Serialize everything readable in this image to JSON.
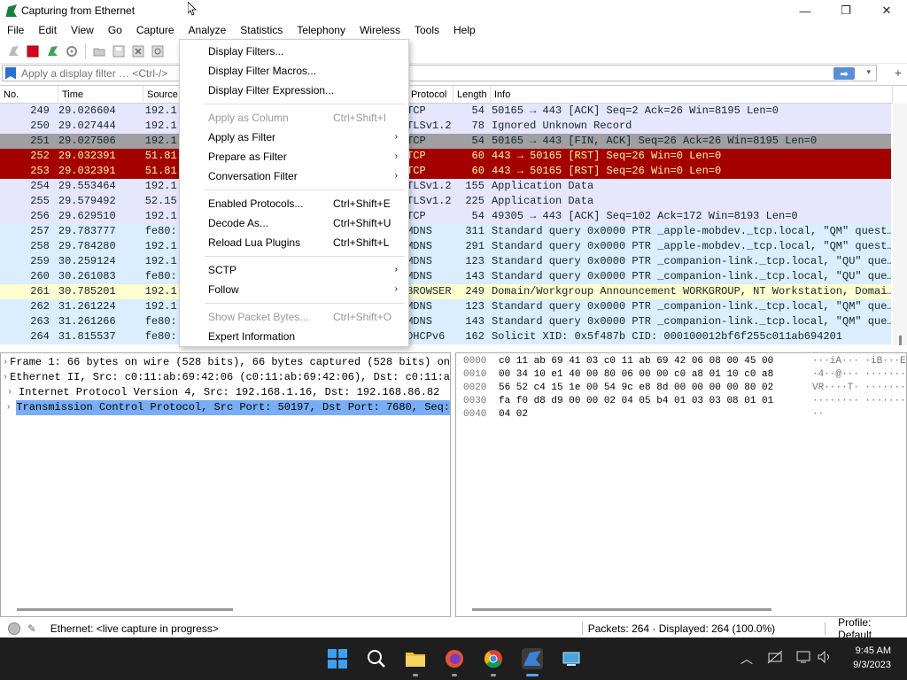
{
  "window": {
    "title": "Capturing from Ethernet",
    "controls": {
      "minimize": "—",
      "maximize": "❐",
      "close": "✕"
    }
  },
  "menubar": [
    "File",
    "Edit",
    "View",
    "Go",
    "Capture",
    "Analyze",
    "Statistics",
    "Telephony",
    "Wireless",
    "Tools",
    "Help"
  ],
  "filter": {
    "placeholder": "Apply a display filter … <Ctrl-/>",
    "apply_glyph": "➡",
    "dropdown_glyph": "▾",
    "add_glyph": "+"
  },
  "packet_list": {
    "columns": [
      "No.",
      "Time",
      "Source",
      "Protocol",
      "Length",
      "Info"
    ],
    "rows": [
      {
        "no": "249",
        "time": "29.026604",
        "src": "192.1",
        "proto": "TCP",
        "len": "54",
        "info": "50165 → 443 [ACK] Seq=2 Ack=26 Win=8195 Len=0",
        "style": "tcp"
      },
      {
        "no": "250",
        "time": "29.027444",
        "src": "192.1",
        "proto": "TLSv1.2",
        "len": "78",
        "info": "Ignored Unknown Record",
        "style": "tcp"
      },
      {
        "no": "251",
        "time": "29.027506",
        "src": "192.1",
        "proto": "TCP",
        "len": "54",
        "info": "50165 → 443 [FIN, ACK] Seq=26 Ack=26 Win=8195 Len=0",
        "style": "fin"
      },
      {
        "no": "252",
        "time": "29.032391",
        "src": "51.81",
        "proto": "TCP",
        "len": "60",
        "info": "443 → 50165 [RST] Seq=26 Win=0 Len=0",
        "style": "rst"
      },
      {
        "no": "253",
        "time": "29.032391",
        "src": "51.81",
        "proto": "TCP",
        "len": "60",
        "info": "443 → 50165 [RST] Seq=26 Win=0 Len=0",
        "style": "rst"
      },
      {
        "no": "254",
        "time": "29.553464",
        "src": "192.1",
        "proto": "TLSv1.2",
        "len": "155",
        "info": "Application Data",
        "style": "tcp"
      },
      {
        "no": "255",
        "time": "29.579492",
        "src": "52.15",
        "proto": "TLSv1.2",
        "len": "225",
        "info": "Application Data",
        "style": "tcp"
      },
      {
        "no": "256",
        "time": "29.629510",
        "src": "192.1",
        "proto": "TCP",
        "len": "54",
        "info": "49305 → 443 [ACK] Seq=102 Ack=172 Win=8193 Len=0",
        "style": "tcp"
      },
      {
        "no": "257",
        "time": "29.783777",
        "src": "fe80:",
        "proto": "MDNS",
        "len": "311",
        "info": "Standard query 0x0000 PTR _apple-mobdev._tcp.local, \"QM\" quest…",
        "style": "udp"
      },
      {
        "no": "258",
        "time": "29.784280",
        "src": "192.1",
        "proto": "MDNS",
        "len": "291",
        "info": "Standard query 0x0000 PTR _apple-mobdev._tcp.local, \"QM\" quest…",
        "style": "udp"
      },
      {
        "no": "259",
        "time": "30.259124",
        "src": "192.1",
        "proto": "MDNS",
        "len": "123",
        "info": "Standard query 0x0000 PTR _companion-link._tcp.local, \"QU\" que…",
        "style": "udp"
      },
      {
        "no": "260",
        "time": "30.261083",
        "src": "fe80:",
        "proto": "MDNS",
        "len": "143",
        "info": "Standard query 0x0000 PTR _companion-link._tcp.local, \"QU\" que…",
        "style": "udp"
      },
      {
        "no": "261",
        "time": "30.785201",
        "src": "192.1",
        "proto": "BROWSER",
        "len": "249",
        "info": "Domain/Workgroup Announcement WORKGROUP, NT Workstation, Domai…",
        "style": "browser"
      },
      {
        "no": "262",
        "time": "31.261224",
        "src": "192.1",
        "proto": "MDNS",
        "len": "123",
        "info": "Standard query 0x0000 PTR _companion-link._tcp.local, \"QM\" que…",
        "style": "udp"
      },
      {
        "no": "263",
        "time": "31.261266",
        "src": "fe80:",
        "proto": "MDNS",
        "len": "143",
        "info": "Standard query 0x0000 PTR _companion-link._tcp.local, \"QM\" que…",
        "style": "udp"
      },
      {
        "no": "264",
        "time": "31.815537",
        "src": "fe80:",
        "proto": "DHCPv6",
        "len": "162",
        "info": "Solicit XID: 0x5f487b CID: 000100012bf6f255c011ab694201",
        "style": "udp"
      }
    ]
  },
  "row_colors": {
    "tcp": {
      "bg": "#e7e6ff",
      "fg": "#12272e"
    },
    "fin": {
      "bg": "#a0a0a0",
      "fg": "#12272e"
    },
    "rst": {
      "bg": "#a40000",
      "fg": "#fffc9c"
    },
    "udp": {
      "bg": "#daeeff",
      "fg": "#12272e"
    },
    "browser": {
      "bg": "#fefed0",
      "fg": "#12272e"
    }
  },
  "details": [
    {
      "text": "Frame 1: 66 bytes on wire (528 bits), 66 bytes captured (528 bits) on",
      "selected": false
    },
    {
      "text": "Ethernet II, Src: c0:11:ab:69:42:06 (c0:11:ab:69:42:06), Dst: c0:11:a",
      "selected": false
    },
    {
      "text": "Internet Protocol Version 4, Src: 192.168.1.16, Dst: 192.168.86.82",
      "selected": false
    },
    {
      "text": "Transmission Control Protocol, Src Port: 50197, Dst Port: 7680, Seq:",
      "selected": true
    }
  ],
  "bytes": [
    {
      "off": "0000",
      "hex": "c0 11 ab 69 41 03 c0 11  ab 69 42 06 08 00 45 00",
      "asc": "···iA··· ·iB···E·"
    },
    {
      "off": "0010",
      "hex": "00 34 10 e1 40 00 80 06  00 00 c0 a8 01 10 c0 a8",
      "asc": "·4··@··· ········"
    },
    {
      "off": "0020",
      "hex": "56 52 c4 15 1e 00 54 9c  e8 8d 00 00 00 00 80 02",
      "asc": "VR····T· ········"
    },
    {
      "off": "0030",
      "hex": "fa f0 d8 d9 00 00 02 04  05 b4 01 03 03 08 01 01",
      "asc": "········ ········"
    },
    {
      "off": "0040",
      "hex": "04 02",
      "asc": "··"
    }
  ],
  "status": {
    "left": "Ethernet: <live capture in progress>",
    "middle": "Packets: 264 · Displayed: 264 (100.0%)",
    "right": "Profile: Default"
  },
  "analyze_menu": [
    {
      "label": "Display Filters...",
      "shortcut": "",
      "submenu": false,
      "disabled": false
    },
    {
      "label": "Display Filter Macros...",
      "shortcut": "",
      "submenu": false,
      "disabled": false
    },
    {
      "label": "Display Filter Expression...",
      "shortcut": "",
      "submenu": false,
      "disabled": false
    },
    {
      "sep": true
    },
    {
      "label": "Apply as Column",
      "shortcut": "Ctrl+Shift+I",
      "submenu": false,
      "disabled": true
    },
    {
      "label": "Apply as Filter",
      "shortcut": "",
      "submenu": true,
      "disabled": false
    },
    {
      "label": "Prepare as Filter",
      "shortcut": "",
      "submenu": true,
      "disabled": false
    },
    {
      "label": "Conversation Filter",
      "shortcut": "",
      "submenu": true,
      "disabled": false
    },
    {
      "sep": true
    },
    {
      "label": "Enabled Protocols...",
      "shortcut": "Ctrl+Shift+E",
      "submenu": false,
      "disabled": false
    },
    {
      "label": "Decode As...",
      "shortcut": "Ctrl+Shift+U",
      "submenu": false,
      "disabled": false
    },
    {
      "label": "Reload Lua Plugins",
      "shortcut": "Ctrl+Shift+L",
      "submenu": false,
      "disabled": false
    },
    {
      "sep": true
    },
    {
      "label": "SCTP",
      "shortcut": "",
      "submenu": true,
      "disabled": false
    },
    {
      "label": "Follow",
      "shortcut": "",
      "submenu": true,
      "disabled": false
    },
    {
      "sep": true
    },
    {
      "label": "Show Packet Bytes...",
      "shortcut": "Ctrl+Shift+O",
      "submenu": false,
      "disabled": true
    },
    {
      "label": "Expert Information",
      "shortcut": "",
      "submenu": false,
      "disabled": false
    }
  ],
  "taskbar": {
    "time": "9:45 AM",
    "date": "9/3/2023"
  }
}
